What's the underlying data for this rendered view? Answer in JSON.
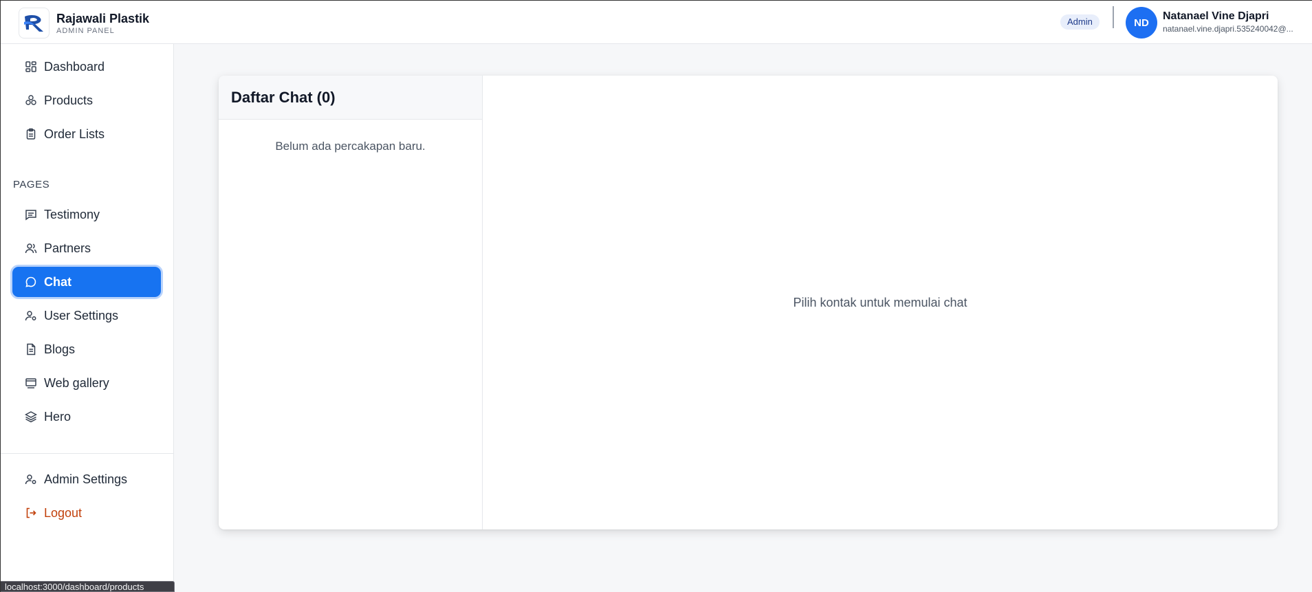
{
  "brand": {
    "name": "Rajawali Plastik",
    "subtitle": "ADMIN PANEL"
  },
  "header": {
    "role_badge": "Admin",
    "user": {
      "initials": "ND",
      "name": "Natanael Vine Djapri",
      "email": "natanael.vine.djapri.535240042@..."
    }
  },
  "sidebar": {
    "main_items": [
      {
        "label": "Dashboard",
        "icon": "dashboard-icon"
      },
      {
        "label": "Products",
        "icon": "products-icon"
      },
      {
        "label": "Order Lists",
        "icon": "clipboard-icon"
      }
    ],
    "section_label": "PAGES",
    "page_items": [
      {
        "label": "Testimony",
        "icon": "message-square-icon"
      },
      {
        "label": "Partners",
        "icon": "users-icon"
      },
      {
        "label": "Chat",
        "icon": "chat-bubble-icon",
        "active": true
      },
      {
        "label": "User Settings",
        "icon": "user-cog-icon"
      },
      {
        "label": "Blogs",
        "icon": "document-icon"
      },
      {
        "label": "Web gallery",
        "icon": "gallery-icon"
      },
      {
        "label": "Hero",
        "icon": "layers-icon"
      }
    ],
    "footer_items": [
      {
        "label": "Admin Settings",
        "icon": "user-cog-icon"
      },
      {
        "label": "Logout",
        "icon": "logout-icon"
      }
    ]
  },
  "chat": {
    "list_title": "Daftar Chat (0)",
    "empty_message": "Belum ada percakapan baru.",
    "placeholder": "Pilih kontak untuk memulai chat"
  },
  "status_bar": {
    "url": "localhost:3000/dashboard/products"
  },
  "colors": {
    "accent": "#1773f1",
    "logout": "#c2410c",
    "background": "#f6f7f9"
  }
}
